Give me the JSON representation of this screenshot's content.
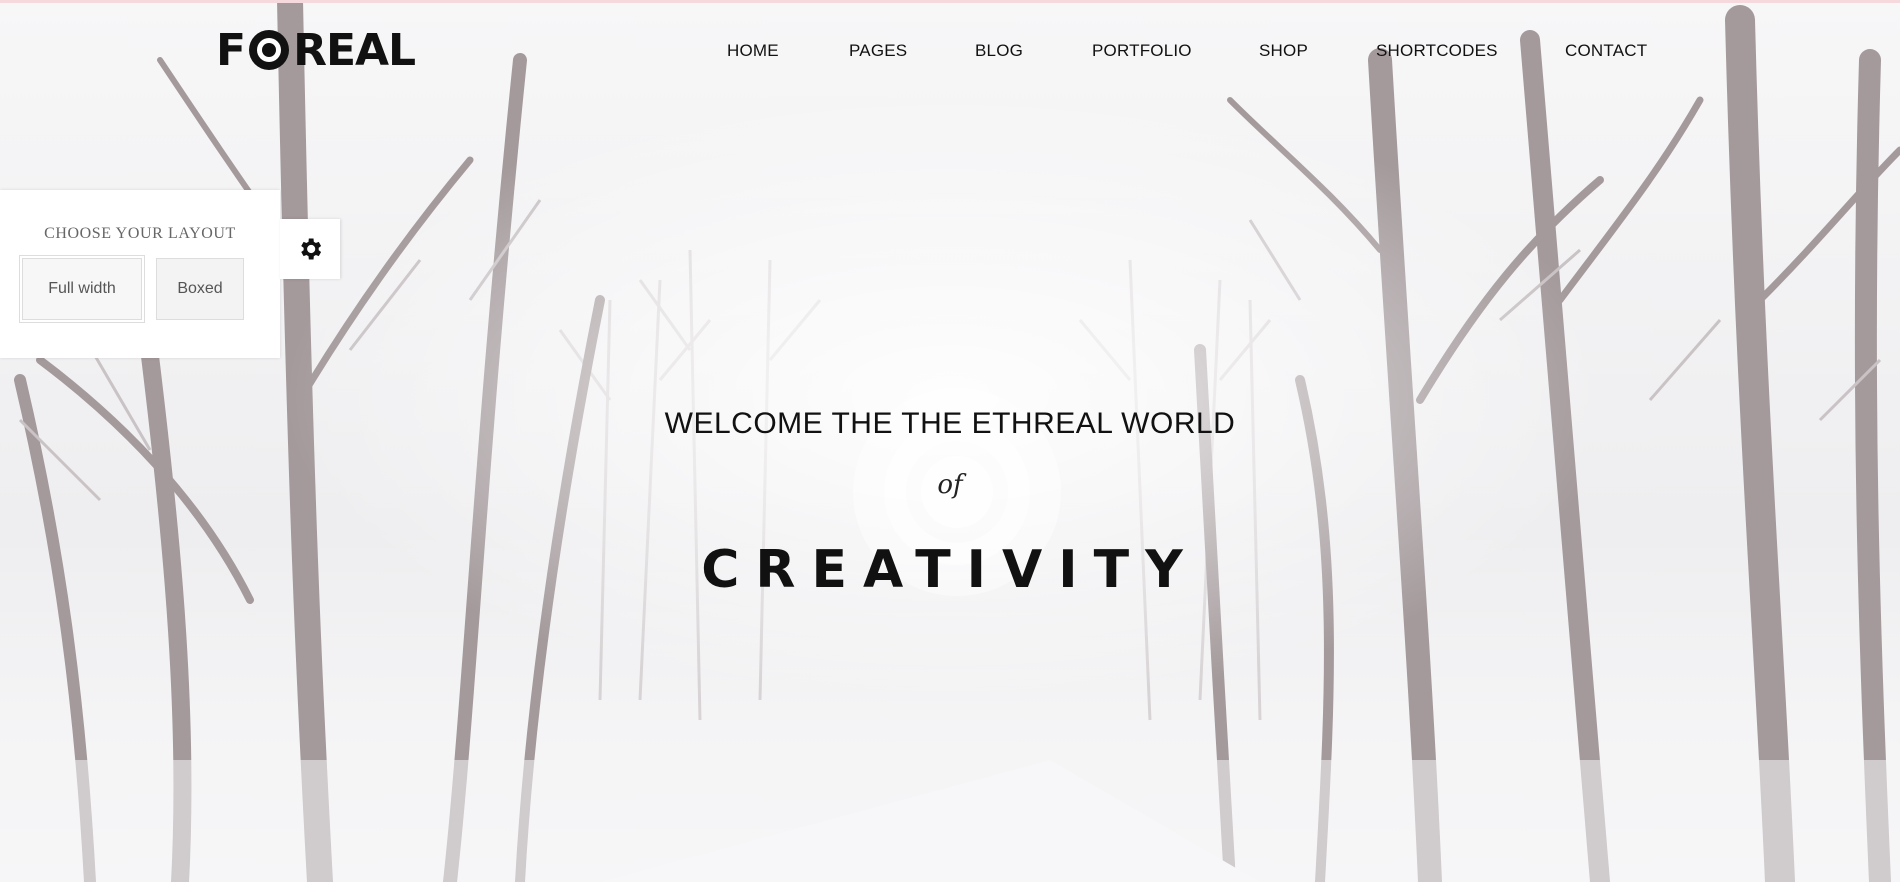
{
  "header": {
    "logo": {
      "pre": "F",
      "post": "REAL"
    },
    "nav": [
      "HOME",
      "PAGES",
      "BLOG",
      "PORTFOLIO",
      "SHOP",
      "SHORTCODES",
      "CONTACT"
    ]
  },
  "layout_switcher": {
    "title": "CHOOSE YOUR LAYOUT",
    "options": [
      "Full width",
      "Boxed"
    ]
  },
  "hero": {
    "line1": "WELCOME THE THE ETHREAL WORLD",
    "line2": "of",
    "line3": "CREATIVITY"
  },
  "colors": {
    "text": "#111111",
    "panel_bg": "#ffffff",
    "accent_line": "#f6d9dc"
  },
  "icons": [
    "gear-icon",
    "logo-o-icon"
  ]
}
